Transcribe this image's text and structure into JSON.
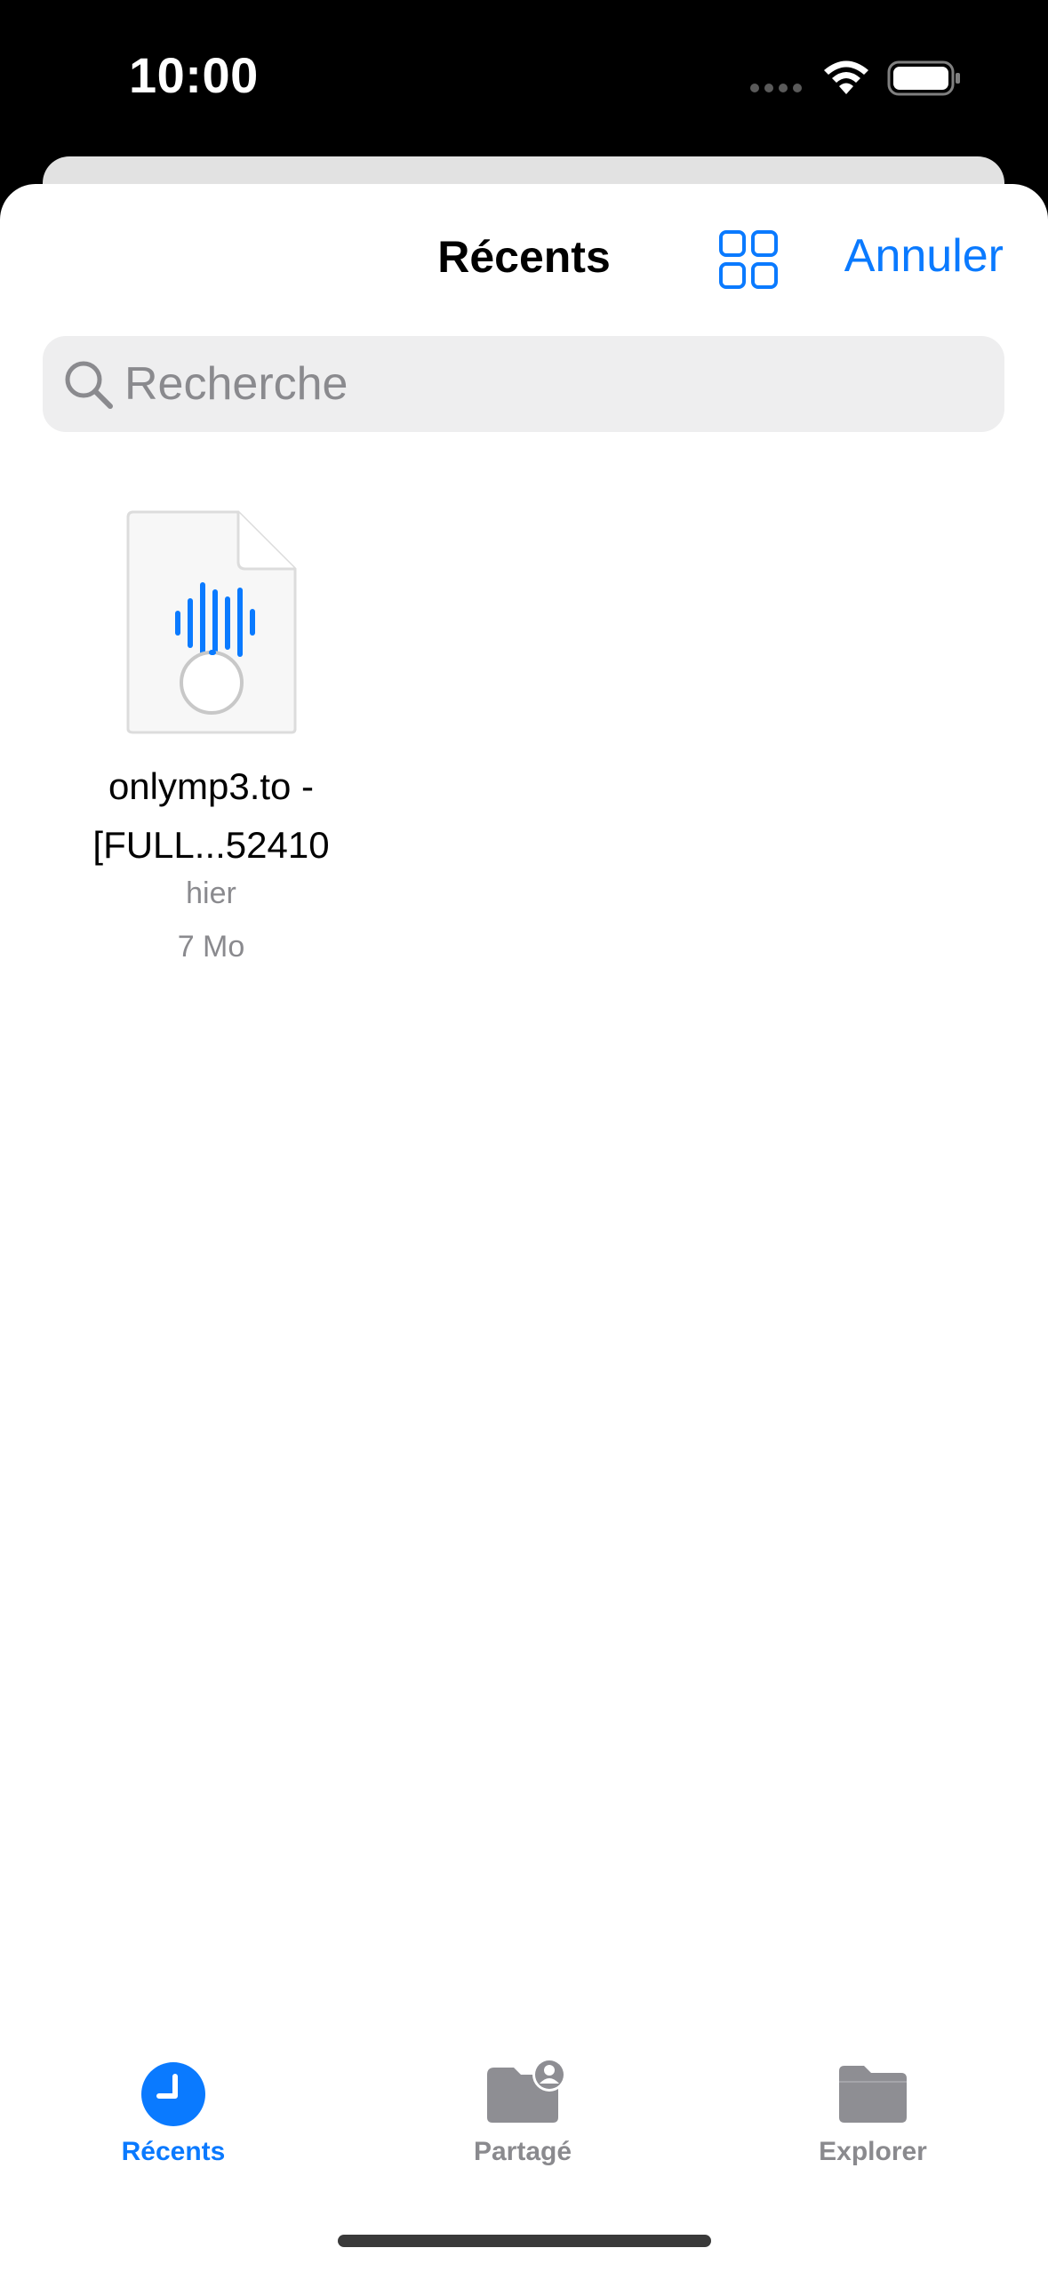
{
  "status_bar": {
    "time": "10:00"
  },
  "header": {
    "title": "Récents",
    "view_toggle_icon": "grid-icon",
    "cancel_label": "Annuler"
  },
  "search": {
    "placeholder": "Recherche",
    "value": ""
  },
  "files": [
    {
      "name_line1": "onlymp3.to -",
      "name_line2": "[FULL...52410",
      "date": "hier",
      "size": "7 Mo",
      "icon": "audio-file-icon",
      "status_icon": "loading-spinner-icon"
    }
  ],
  "tab_bar": {
    "items": [
      {
        "label": "Récents",
        "icon": "clock-icon",
        "active": true
      },
      {
        "label": "Partagé",
        "icon": "shared-folder-icon",
        "active": false
      },
      {
        "label": "Explorer",
        "icon": "folder-icon",
        "active": false
      }
    ]
  },
  "colors": {
    "accent": "#0a7aff",
    "secondary_text": "#8a8a8e",
    "search_background": "#eeeeef",
    "inactive_icon": "#8e8e93"
  }
}
